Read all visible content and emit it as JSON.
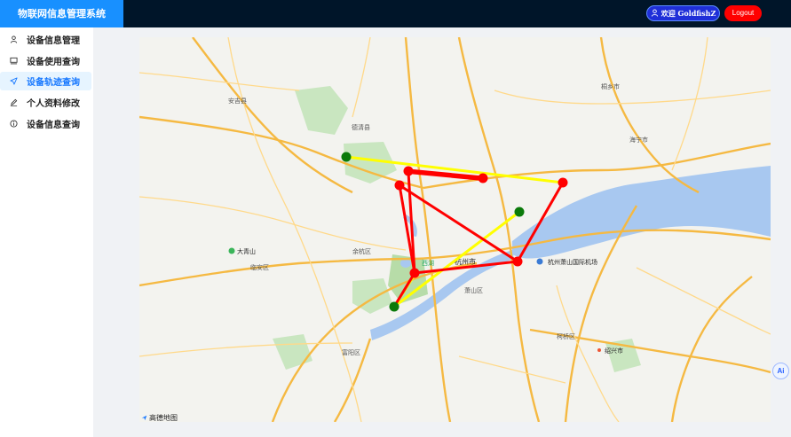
{
  "app": {
    "title": "物联网信息管理系统"
  },
  "header": {
    "welcome_label": "欢迎 GoldfishZ",
    "logout_label": "Logout"
  },
  "sidebar": {
    "items": [
      {
        "label": "设备信息管理",
        "icon": "user-icon",
        "active": false
      },
      {
        "label": "设备使用查询",
        "icon": "monitor-icon",
        "active": false
      },
      {
        "label": "设备轨迹查询",
        "icon": "send-icon",
        "active": true
      },
      {
        "label": "个人资料修改",
        "icon": "edit-icon",
        "active": false
      },
      {
        "label": "设备信息查询",
        "icon": "info-icon",
        "active": false
      }
    ]
  },
  "map": {
    "provider_label": "高德地图",
    "places": {
      "city": "杭州市",
      "west_lake": "西湖",
      "airport": "杭州萧山国际机场",
      "shaoxing": "绍兴市",
      "mountain": "大青山",
      "deqing": "德清县",
      "haining": "海宁市",
      "xiaoshan": "萧山区",
      "yuhang": "余杭区",
      "linan": "临安区",
      "fuyang": "富阳区",
      "keqiao": "柯桥区",
      "tongxiang": "桐乡市",
      "anji": "安吉县"
    },
    "colors": {
      "track_red": "#ff0000",
      "track_yellow": "#ffff00",
      "marker_green": "#0a7a0a",
      "river": "#a8c8f0"
    }
  },
  "ai_button": {
    "label": "Ai"
  }
}
